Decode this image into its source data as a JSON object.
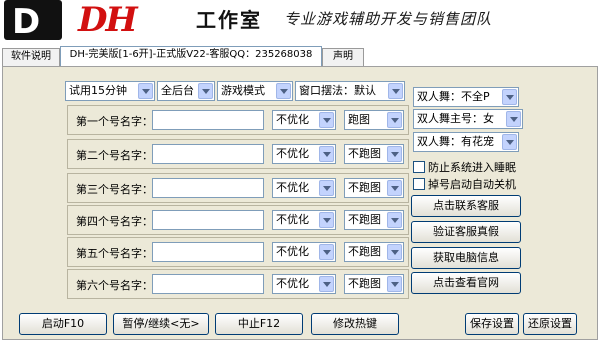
{
  "banner": {
    "logo_letter": "D",
    "brand": "DH",
    "studio": "工作室",
    "slogan": "专业游戏辅助开发与销售团队"
  },
  "tabs": [
    {
      "label": "软件说明",
      "active": false
    },
    {
      "label": "DH-完美版[1-6开]-正式版V22-客服QQ：235268038",
      "active": true
    },
    {
      "label": "声明",
      "active": false
    }
  ],
  "options": {
    "trial": "试用15分钟",
    "background": "全后台",
    "mode": "游戏模式",
    "window_layout": "窗口摆法：默认"
  },
  "accounts": [
    {
      "label": "第一个号名字：",
      "value": "",
      "optimize": "不优化",
      "run": "跑图"
    },
    {
      "label": "第二个号名字：",
      "value": "",
      "optimize": "不优化",
      "run": "不跑图"
    },
    {
      "label": "第三个号名字：",
      "value": "",
      "optimize": "不优化",
      "run": "不跑图"
    },
    {
      "label": "第四个号名字：",
      "value": "",
      "optimize": "不优化",
      "run": "不跑图"
    },
    {
      "label": "第五个号名字：",
      "value": "",
      "optimize": "不优化",
      "run": "不跑图"
    },
    {
      "label": "第六个号名字：",
      "value": "",
      "optimize": "不优化",
      "run": "不跑图"
    }
  ],
  "right": {
    "dance_p": "双人舞：不全P",
    "dance_main": "双人舞主号：女",
    "dance_pet": "双人舞：有花宠",
    "prevent_sleep": "防止系统进入睡眠",
    "auto_shutdown": "掉号启动自动关机",
    "contact_btn": "点击联系客服",
    "verify_btn": "验证客服真假",
    "pcinfo_btn": "获取电脑信息",
    "site_btn": "点击查看官网"
  },
  "bottom": {
    "start": "启动F10",
    "pause": "暂停/继续<无>",
    "stop": "中止F12",
    "hotkey": "修改热键",
    "save": "保存设置",
    "reset": "还原设置"
  }
}
